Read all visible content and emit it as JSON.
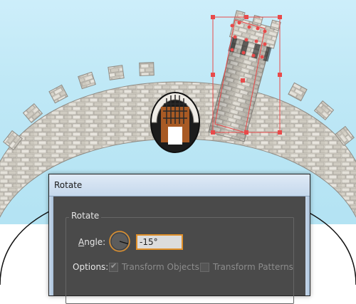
{
  "dialog": {
    "title": "Rotate",
    "group_label": "Rotate",
    "angle": {
      "label_prefix": "",
      "label_mnemonic": "A",
      "label_rest": "ngle:",
      "value": "-15°"
    },
    "options": {
      "label": "Options:",
      "transform_objects": {
        "label": "Transform Objects",
        "checked": true,
        "enabled": false
      },
      "transform_patterns": {
        "label": "Transform Patterns",
        "checked": false,
        "enabled": false
      }
    }
  },
  "artwork": {
    "colors": {
      "sky": "#cdeefa",
      "brick": "#dcd8cf",
      "mortar": "#9e9a92",
      "gate_wood": "#a85a24",
      "selection": "#e84a4a"
    },
    "icons": [
      "gate-icon",
      "tower-icon",
      "dial-icon",
      "checkbox-icon"
    ]
  }
}
